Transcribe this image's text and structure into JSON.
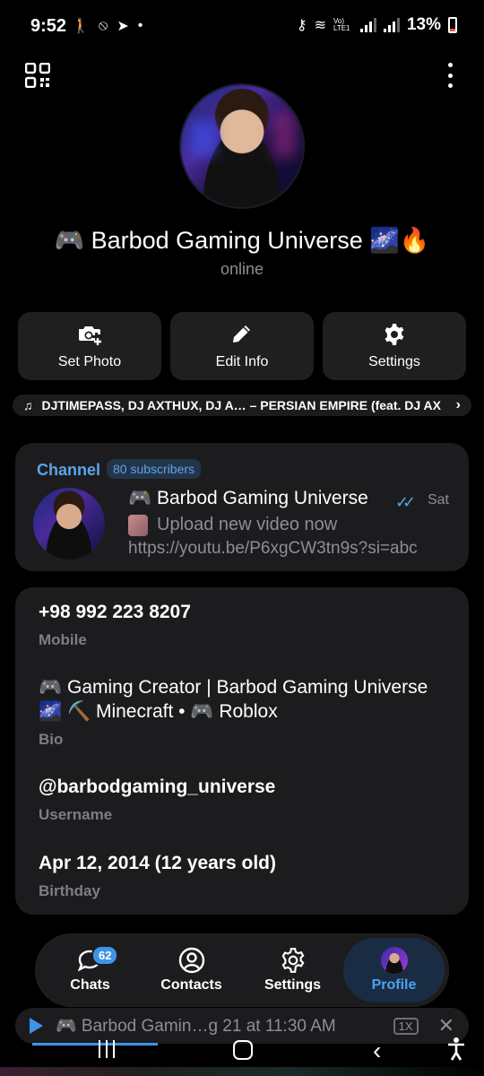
{
  "status_bar": {
    "time": "9:52",
    "battery_percent": "13%",
    "lte_label": "Vo) LTE1"
  },
  "profile": {
    "name": "🎮 Barbod Gaming Universe 🌌🔥",
    "status": "online"
  },
  "actions": {
    "set_photo": "Set Photo",
    "edit_info": "Edit Info",
    "settings": "Settings"
  },
  "music": {
    "text": "DJTIMEPASS, DJ AXTHUX, DJ A… – PERSIAN EMPIRE (feat. DJ AX"
  },
  "channel": {
    "label": "Channel",
    "subscribers": "80 subscribers",
    "title": "🎮 Barbod Gaming Universe",
    "date": "Sat",
    "line1": "Upload new video now",
    "line2": "https://youtu.be/P6xgCW3tn9s?si=abc"
  },
  "info": {
    "phone": "+98 992 223 8207",
    "phone_label": "Mobile",
    "bio": "🎮 Gaming Creator | Barbod Gaming Universe 🌌 ⛏️ Minecraft • 🎮 Roblox",
    "bio_label": "Bio",
    "username": "@barbodgaming_universe",
    "username_label": "Username",
    "birthday": "Apr 12, 2014 (12 years old)",
    "birthday_label": "Birthday"
  },
  "nav": {
    "chats": "Chats",
    "chats_badge": "62",
    "contacts": "Contacts",
    "settings": "Settings",
    "profile": "Profile"
  },
  "player": {
    "title": "🎮 Barbod Gamin…g 21 at 11:30 AM",
    "speed": "1X"
  },
  "colors": {
    "accent": "#3f93e8",
    "card": "#1c1c1e",
    "background": "#000000"
  }
}
